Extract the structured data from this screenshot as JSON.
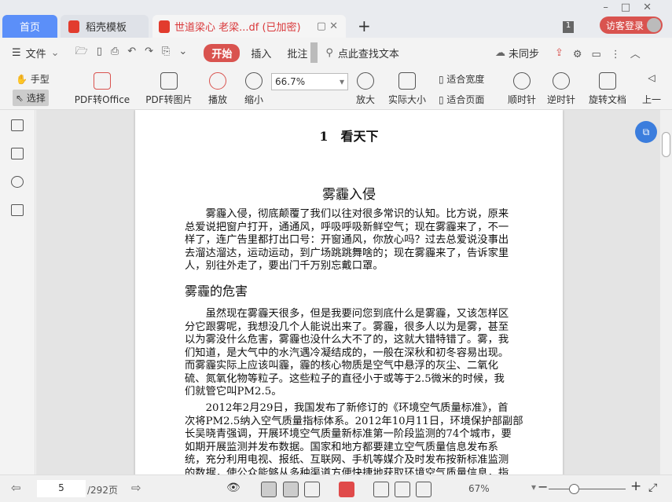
{
  "tabs": {
    "home": "首页",
    "template": "稻壳模板",
    "document": "世道梁心 老梁...df (已加密)",
    "new_tab": "+",
    "badge": "1",
    "login": "访客登录"
  },
  "toolbar": {
    "menu": "文件",
    "start": "开始",
    "insert": "插入",
    "annotate": "批注",
    "search": "点此查找文本",
    "sync": "未同步"
  },
  "ribbon": {
    "hand": "手型",
    "select": "选择",
    "pdf_office": "PDF转Office",
    "pdf_image": "PDF转图片",
    "play": "播放",
    "zoom_out": "缩小",
    "zoom_value": "66.7%",
    "zoom_in": "放大",
    "actual": "实际大小",
    "fit_width": "适合宽度",
    "fit_page": "适合页面",
    "cw": "顺时针",
    "ccw": "逆时针",
    "rotate": "旋转文档",
    "prev": "上一"
  },
  "document": {
    "chapter": "1　看天下",
    "title": "雾霾入侵",
    "p1": [
      "　　雾霾入侵，彻底颠覆了我们以往对很多常识的认知。比方说，原来",
      "总爱说把窗户打开，通通风，呼吸呼吸新鲜空气；现在雾霾来了，不一",
      "样了，连广告里都打出口号：开窗通风，你放心吗？过去总爱说没事出",
      "去溜达溜达，运动运动，到广场跳跳舞啥的；现在雾霾来了，告诉家里",
      "人，别往外走了，要出门千万别忘戴口罩。"
    ],
    "heading2": "雾霾的危害",
    "p2": [
      "　　虽然现在雾霾天很多，但是我要问您到底什么是雾霾，又该怎样区",
      "分它跟雾呢，我想没几个人能说出来了。雾霾，很多人以为是雾，甚至",
      "以为雾没什么危害，雾霾也没什么大不了的，这就大错特错了。雾，我",
      "们知道，是大气中的水汽遇冷凝结成的，一般在深秋和初冬容易出现。",
      "而雾霾实际上应该叫霾，霾的核心物质是空气中悬浮的灰尘、二氧化",
      "硫、氮氧化物等粒子。这些粒子的直径小于或等于2.5微米的时候，我",
      "们就管它叫PM2.5。"
    ],
    "p3": [
      "　　2012年2月29日，我国发布了新修订的《环境空气质量标准》，首",
      "次将PM2.5纳入空气质量指标体系。2012年10月11日，环境保护部副部",
      "长吴晓青强调，开展环境空气质量新标准第一阶段监测的74个城市，要",
      "如期开展监测并发布数据。国家和地方都要建立空气质量信息发布系",
      "统，充分利用电视、报纸、互联网、手机等媒介及时发布按新标准监测",
      "的数据，使公众能够从多种渠道方便快捷地获取环境空气质量信息，指"
    ]
  },
  "status": {
    "page": "5",
    "total": "/292页",
    "zoom": "67%"
  }
}
